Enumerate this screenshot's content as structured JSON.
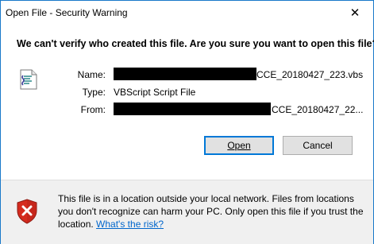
{
  "window": {
    "title": "Open File - Security Warning",
    "close_glyph": "✕"
  },
  "headline": "We can't verify who created this file. Are you sure you want to open this file?",
  "details": {
    "name_label": "Name:",
    "name_value": "CCE_20180427_223.vbs",
    "type_label": "Type:",
    "type_value": "VBScript Script File",
    "from_label": "From:",
    "from_value": "CCE_20180427_22..."
  },
  "buttons": {
    "open_label": "Open",
    "cancel_label": "Cancel"
  },
  "footer": {
    "warning_text": "This file is in a location outside your local network. Files from locations you don't recognize can harm your PC. Only open this file if you trust the location.",
    "risk_link": "What's the risk?"
  },
  "icons": {
    "file": "vbscript-file-icon",
    "shield": "security-shield-icon"
  },
  "colors": {
    "accent": "#0078d7",
    "window_border": "#1979ca",
    "footer_bg": "#f0f0f0",
    "link": "#0066cc",
    "shield_red": "#d52b1e"
  }
}
